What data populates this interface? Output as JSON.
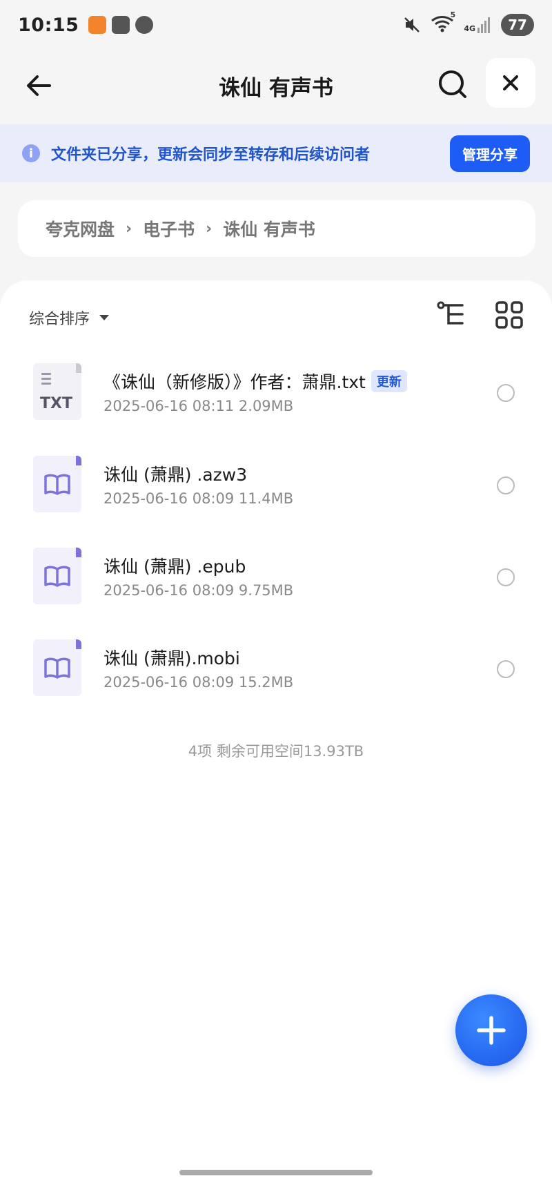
{
  "status_bar": {
    "time": "10:15",
    "battery": "77",
    "network": "4G",
    "wifi_badge": "5"
  },
  "header": {
    "title": "诛仙 有声书"
  },
  "banner": {
    "text": "文件夹已分享，更新会同步至转存和后续访问者",
    "button_label": "管理分享"
  },
  "breadcrumb": {
    "items": [
      "夸克网盘",
      "电子书",
      "诛仙 有声书"
    ]
  },
  "toolbar": {
    "sort_label": "综合排序"
  },
  "files": [
    {
      "name": "《诛仙（新修版）》作者：萧鼎.txt",
      "meta": "2025-06-16 08:11  2.09MB",
      "type": "txt",
      "thumb_label": "TXT",
      "badge": "更新"
    },
    {
      "name": "诛仙 (萧鼎) .azw3",
      "meta": "2025-06-16 08:09  11.4MB",
      "type": "book"
    },
    {
      "name": "诛仙 (萧鼎) .epub",
      "meta": "2025-06-16 08:09  9.75MB",
      "type": "book"
    },
    {
      "name": "诛仙 (萧鼎).mobi",
      "meta": "2025-06-16 08:09  15.2MB",
      "type": "book"
    }
  ],
  "summary": "4项 剩余可用空间13.93TB",
  "colors": {
    "accent": "#1d5cf5",
    "banner_bg": "#e9ecfb",
    "banner_text": "#1f55c9",
    "book_icon": "#7d72d9"
  }
}
